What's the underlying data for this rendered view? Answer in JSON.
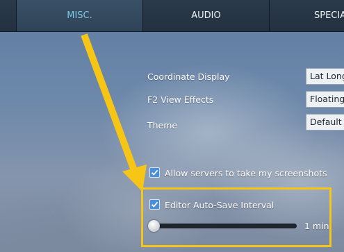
{
  "tabs": {
    "misc": "MISC.",
    "audio": "AUDIO",
    "special": "SPECIA"
  },
  "settings": {
    "coordinate_display": {
      "label": "Coordinate Display",
      "value": "Lat Long"
    },
    "f2_view_effects": {
      "label": "F2 View Effects",
      "value": "Floating"
    },
    "theme": {
      "label": "Theme",
      "value": "Default t"
    }
  },
  "checkboxes": {
    "allow_screenshots": {
      "label": "Allow servers to take my screenshots",
      "checked": true
    },
    "editor_autosave": {
      "label": "Editor Auto-Save Interval",
      "checked": true
    }
  },
  "autosave_slider": {
    "value_label": "1 min",
    "position_fraction": 0
  },
  "colors": {
    "accent_tab": "#7fc7e6",
    "checkbox": "#4a8fd8",
    "highlight": "#f5c518"
  },
  "icons": {
    "annotation_arrow": "arrow-icon",
    "check": "check-icon"
  }
}
